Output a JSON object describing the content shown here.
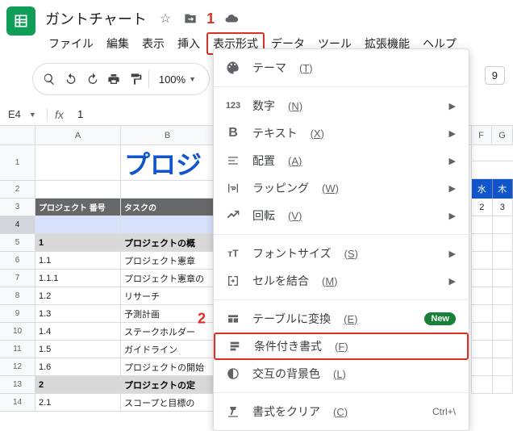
{
  "doc": {
    "title": "ガントチャート"
  },
  "annotations": {
    "one": "1",
    "two": "2"
  },
  "menubar": [
    "ファイル",
    "編集",
    "表示",
    "挿入",
    "表示形式",
    "データ",
    "ツール",
    "拡張機能",
    "ヘルプ"
  ],
  "toolbar": {
    "zoom": "100%"
  },
  "namebox": "E4",
  "fx_value": "1",
  "columns": {
    "A": "A",
    "B": "B",
    "F": "F",
    "G": "G"
  },
  "sheet": {
    "title": "プロジ",
    "header": {
      "A": "プロジェクト 番号",
      "B": "タスクの"
    },
    "rows": [
      {
        "n": "1",
        "a": "1",
        "b": "プロジェクトの概",
        "sub": true
      },
      {
        "n": "1.1",
        "b": "プロジェクト憲章"
      },
      {
        "n": "1.1.1",
        "b": "プロジェクト憲章の"
      },
      {
        "n": "1.2",
        "b": "リサーチ"
      },
      {
        "n": "1.3",
        "b": "予測計画"
      },
      {
        "n": "1.4",
        "b": "ステークホルダー"
      },
      {
        "n": "1.5",
        "b": "ガイドライン"
      },
      {
        "n": "1.6",
        "b": "プロジェクトの開始"
      },
      {
        "n": "2",
        "a": "2",
        "b": "プロジェクトの定",
        "sub": true
      },
      {
        "n": "2.1",
        "b": "スコープと目標の"
      }
    ],
    "days": {
      "wed": "水",
      "thu": "木",
      "d1": "2",
      "d2": "3"
    }
  },
  "menu": {
    "theme": {
      "label": "テーマ",
      "sc": "(T)"
    },
    "number": {
      "label": "数字",
      "sc": "(N)",
      "icon": "123"
    },
    "text": {
      "label": "テキスト",
      "sc": "(X)"
    },
    "align": {
      "label": "配置",
      "sc": "(A)"
    },
    "wrap": {
      "label": "ラッピング",
      "sc": "(W)"
    },
    "rotate": {
      "label": "回転",
      "sc": "(V)"
    },
    "fontsize": {
      "label": "フォントサイズ",
      "sc": "(S)"
    },
    "merge": {
      "label": "セルを結合",
      "sc": "(M)"
    },
    "table": {
      "label": "テーブルに変換",
      "sc": "(E)",
      "badge": "New"
    },
    "cond": {
      "label": "条件付き書式",
      "sc": "(F)"
    },
    "alt": {
      "label": "交互の背景色",
      "sc": "(L)"
    },
    "clear": {
      "label": "書式をクリア",
      "sc": "(C)",
      "kbd": "Ctrl+\\"
    }
  },
  "right_badge": "9"
}
